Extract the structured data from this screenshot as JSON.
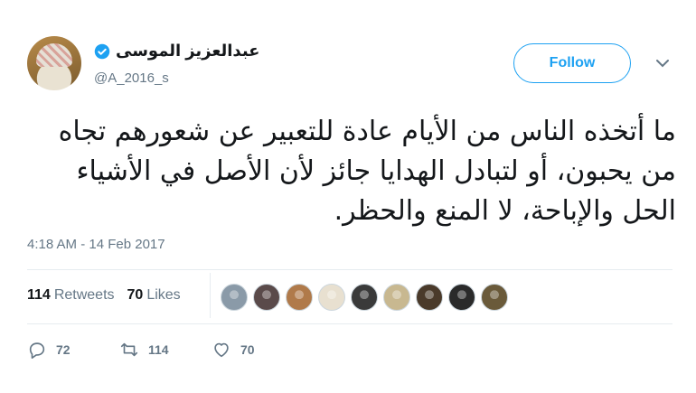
{
  "author": {
    "display_name": "عبدالعزيز الموسى",
    "handle": "@A_2016_s",
    "verified": true
  },
  "follow_button": {
    "label": "Follow"
  },
  "tweet": {
    "text": "ما أتخذه الناس من الأيام عادة للتعبير عن شعورهم تجاه من يحبون، أو لتبادل الهدايا جائز لأن الأصل في الأشياء الحل والإباحة، لا المنع والحظر.",
    "timestamp": "4:18 AM - 14 Feb 2017"
  },
  "stats": {
    "retweets_count": "114",
    "retweets_label": "Retweets",
    "likes_count": "70",
    "likes_label": "Likes"
  },
  "likers": [
    {
      "color": "#8a9aa8"
    },
    {
      "color": "#5a4a4a"
    },
    {
      "color": "#b07a4a"
    },
    {
      "color": "#e8e0d0"
    },
    {
      "color": "#3a3a3a"
    },
    {
      "color": "#c8b890"
    },
    {
      "color": "#4a3a2a"
    },
    {
      "color": "#2a2a2a"
    },
    {
      "color": "#6a5a3a"
    }
  ],
  "actions": {
    "reply_count": "72",
    "retweet_count": "114",
    "like_count": "70"
  },
  "colors": {
    "accent": "#1da1f2",
    "muted": "#657786",
    "text": "#14171a"
  }
}
